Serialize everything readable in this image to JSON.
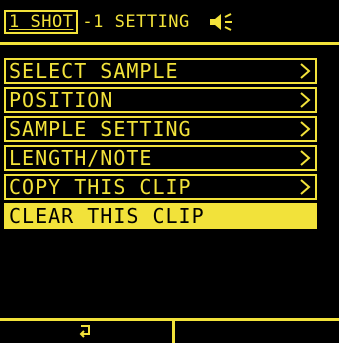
{
  "header": {
    "mode_tag": "1 SHOT",
    "title": "-1 SETTING",
    "icons": {
      "sound": "speaker-icon"
    }
  },
  "menu": {
    "items": [
      {
        "label": "SELECT SAMPLE",
        "has_submenu": true
      },
      {
        "label": "POSITION",
        "has_submenu": true
      },
      {
        "label": "SAMPLE SETTING",
        "has_submenu": true
      },
      {
        "label": "LENGTH/NOTE",
        "has_submenu": true
      },
      {
        "label": "COPY THIS CLIP",
        "has_submenu": true
      },
      {
        "label": "CLEAR THIS CLIP",
        "has_submenu": false,
        "selected": true
      }
    ]
  },
  "footer": {
    "soft_keys": [
      {
        "icon": "back-arrow-icon"
      },
      {
        "icon": ""
      }
    ]
  },
  "colors": {
    "foreground": "#f2e23a",
    "background": "#000000"
  }
}
